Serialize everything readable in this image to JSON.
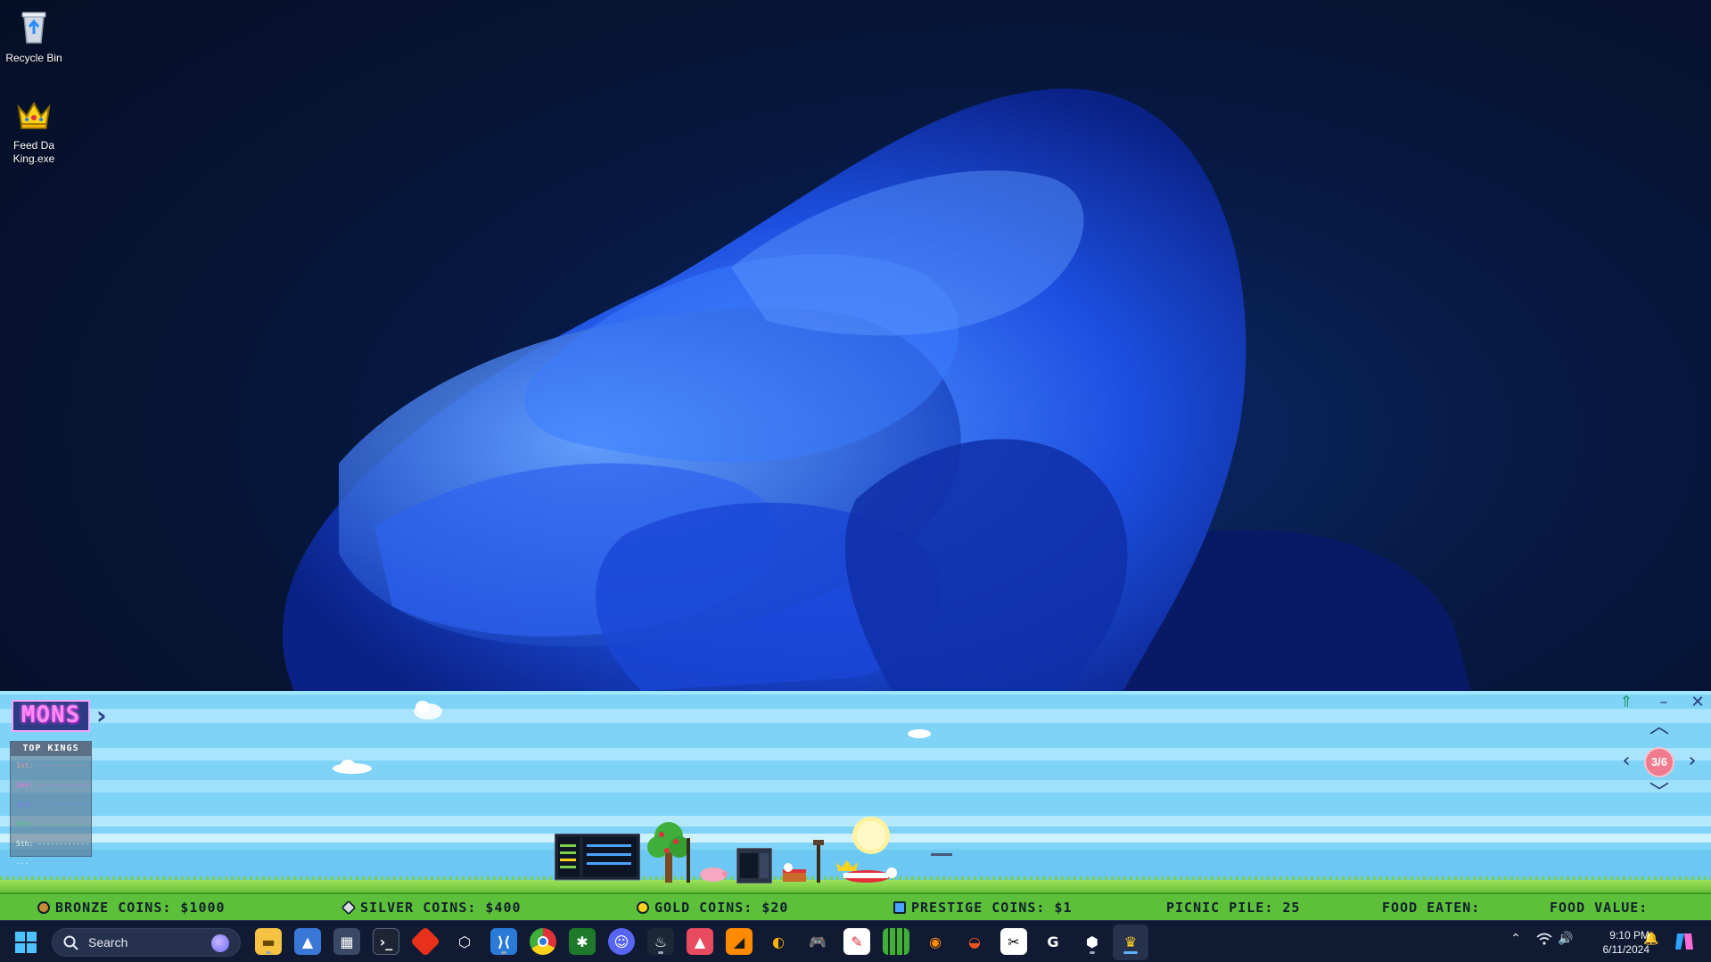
{
  "desktop": {
    "icons": [
      {
        "label": "Recycle Bin",
        "icon": "recycle-bin-icon"
      },
      {
        "label": "Feed Da\nKing.exe",
        "icon": "crown-icon"
      }
    ]
  },
  "game": {
    "logo_text": "MONS",
    "leaderboard": {
      "title": "TOP KINGS",
      "rows": [
        "1st: ---------------",
        "2nd: ---------------",
        "3rd: ---------------",
        "4th: ---------------",
        "5th: ---------------"
      ]
    },
    "page_indicator": "3/6",
    "stats": {
      "bronze": "BRONZE COINS: $1000",
      "silver": "SILVER COINS: $400",
      "gold": "GOLD COINS: $20",
      "prestige": "PRESTIGE COINS: $1",
      "picnic": "PICNIC PILE: 25",
      "food_eaten": "FOOD EATEN:",
      "food_value": "FOOD VALUE:"
    },
    "colors": {
      "sky": "#7fd3f7",
      "grass": "#5dc03a",
      "logo_pink": "#ff8af5",
      "badge": "#f07a8e"
    }
  },
  "taskbar": {
    "search_placeholder": "Search",
    "apps": [
      "file-explorer-icon",
      "photos-icon",
      "calculator-icon",
      "terminal-icon",
      "git-icon",
      "unity-icon",
      "vscode-icon",
      "chrome-icon",
      "xbox-icon",
      "discord-icon",
      "steam-icon",
      "drawing-app-icon",
      "sublime-icon",
      "pen-tool-icon",
      "controller-icon",
      "paint-icon",
      "grid-app-icon",
      "blender-icon",
      "ubuntu-icon",
      "capcut-icon",
      "g-app-icon",
      "unity-hub-icon",
      "feed-da-king-icon"
    ],
    "clock": {
      "time": "9:10 PM",
      "date": "6/11/2024"
    }
  }
}
